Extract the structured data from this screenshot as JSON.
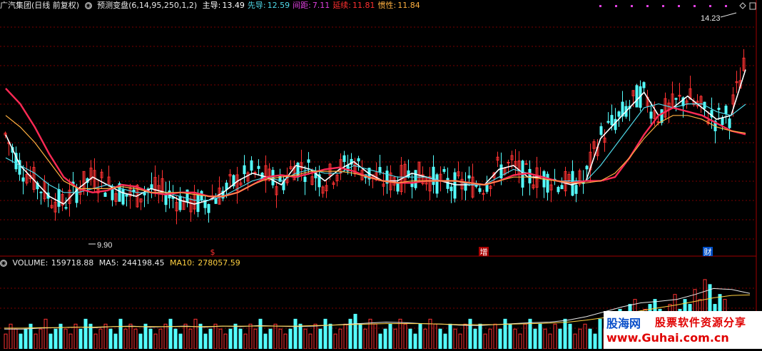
{
  "header": {
    "stock": "广汽集团(日线 前复权)",
    "indicator": "预测变盘(6,14,95,250,1,2)",
    "items": [
      {
        "label": "主导:",
        "value": "13.49",
        "color": "#ffffff"
      },
      {
        "label": "先导:",
        "value": "12.59",
        "color": "#4fd8e8"
      },
      {
        "label": "间距:",
        "value": "7.11",
        "color": "#e040e0"
      },
      {
        "label": "延续:",
        "value": "11.81",
        "color": "#ff3030"
      },
      {
        "label": "惯性:",
        "value": "11.84",
        "color": "#ffb040"
      }
    ]
  },
  "volume_header": {
    "title": "VOLUME:",
    "value": "159718.88",
    "ma5_label": "MA5:",
    "ma5_value": "244198.45",
    "ma10_label": "MA10:",
    "ma10_value": "278057.59"
  },
  "price_labels": {
    "high": "14.23",
    "low": "9.90"
  },
  "markers": [
    "$",
    "增",
    "财"
  ],
  "watermark": {
    "brand": "股海网",
    "slogan": "股票软件资源分享",
    "url": "www.Guhai.com.cn"
  },
  "colors": {
    "up": "#ff3232",
    "down": "#54ffff",
    "main": "#ffffff",
    "lead": "#4fd8e8",
    "continue": "#ff2a55",
    "inertia": "#ffb040",
    "grid": "#7a0000"
  },
  "chart_data": {
    "type": "line",
    "price_range": [
      9.0,
      15.0
    ],
    "series": [
      {
        "name": "主导",
        "values": [
          11.8,
          11.0,
          10.6,
          10.2,
          10.0,
          10.4,
          10.7,
          10.5,
          10.3,
          10.2,
          10.4,
          10.3,
          10.1,
          10.0,
          10.1,
          10.3,
          10.6,
          10.8,
          10.7,
          10.5,
          11.0,
          10.9,
          10.6,
          10.9,
          11.1,
          10.8,
          10.6,
          10.6,
          10.8,
          10.7,
          10.6,
          10.5,
          10.5,
          10.5,
          10.9,
          11.0,
          10.7,
          10.7,
          10.6,
          10.5,
          10.6,
          11.7,
          12.1,
          12.5,
          12.9,
          12.3,
          12.5,
          12.8,
          12.5,
          12.2,
          12.3,
          13.49
        ]
      },
      {
        "name": "先导",
        "values": [
          11.2,
          11.0,
          10.8,
          10.5,
          10.3,
          10.3,
          10.4,
          10.5,
          10.4,
          10.3,
          10.3,
          10.3,
          10.2,
          10.1,
          10.1,
          10.2,
          10.4,
          10.6,
          10.7,
          10.6,
          10.8,
          10.9,
          10.8,
          10.8,
          11.0,
          10.9,
          10.8,
          10.7,
          10.7,
          10.7,
          10.6,
          10.6,
          10.5,
          10.5,
          10.7,
          10.9,
          10.8,
          10.7,
          10.6,
          10.6,
          10.6,
          11.0,
          11.5,
          12.0,
          12.5,
          12.6,
          12.5,
          12.6,
          12.6,
          12.4,
          12.3,
          12.59
        ]
      },
      {
        "name": "延续",
        "values": [
          13.0,
          12.6,
          12.0,
          11.3,
          10.7,
          10.4,
          10.3,
          10.35,
          10.5,
          10.45,
          10.3,
          10.25,
          10.3,
          10.3,
          10.2,
          10.2,
          10.3,
          10.5,
          10.7,
          10.75,
          10.7,
          10.8,
          10.9,
          10.95,
          10.85,
          10.7,
          10.6,
          10.55,
          10.55,
          10.6,
          10.6,
          10.6,
          10.55,
          10.5,
          10.6,
          10.75,
          10.8,
          10.7,
          10.6,
          10.55,
          10.6,
          10.6,
          10.7,
          11.2,
          11.8,
          12.3,
          12.5,
          12.4,
          12.3,
          12.1,
          11.9,
          11.81
        ]
      },
      {
        "name": "惯性",
        "values": [
          12.3,
          12.0,
          11.6,
          11.1,
          10.6,
          10.4,
          10.4,
          10.4,
          10.45,
          10.4,
          10.3,
          10.3,
          10.3,
          10.25,
          10.2,
          10.2,
          10.3,
          10.5,
          10.65,
          10.7,
          10.75,
          10.85,
          10.85,
          10.85,
          10.8,
          10.7,
          10.6,
          10.55,
          10.6,
          10.6,
          10.6,
          10.6,
          10.55,
          10.5,
          10.6,
          10.7,
          10.7,
          10.65,
          10.6,
          10.55,
          10.55,
          10.6,
          10.8,
          11.2,
          11.7,
          12.1,
          12.3,
          12.3,
          12.2,
          12.0,
          11.9,
          11.84
        ]
      }
    ],
    "volume": {
      "values": [
        3,
        5,
        4,
        3,
        4,
        5,
        3,
        4,
        6,
        3,
        4,
        5,
        4,
        3,
        5,
        4,
        6,
        5,
        3,
        4,
        5,
        4,
        3,
        6,
        4,
        5,
        4,
        3,
        5,
        4,
        3,
        4,
        5,
        6,
        4,
        3,
        5,
        4,
        6,
        5,
        3,
        4,
        5,
        4,
        3,
        4,
        5,
        4,
        3,
        5,
        4,
        6,
        3,
        4,
        5,
        4,
        3,
        4,
        6,
        5,
        4,
        3,
        5,
        4,
        6,
        5,
        3,
        4,
        5,
        6,
        7,
        5,
        4,
        6,
        5,
        3,
        4,
        5,
        4,
        6,
        5,
        4,
        3,
        5,
        4,
        6,
        5,
        4,
        3,
        5,
        4,
        3,
        5,
        6,
        4,
        5,
        3,
        4,
        5,
        4,
        6,
        5,
        4,
        3,
        5,
        6,
        4,
        5,
        4,
        3,
        5,
        4,
        6,
        5,
        3,
        4,
        5,
        4,
        3,
        6,
        4,
        5,
        7,
        8,
        6,
        9,
        10,
        7,
        8,
        9,
        10,
        8,
        7,
        9,
        11,
        8,
        10,
        9,
        12,
        10,
        14,
        13,
        9,
        11,
        10
      ],
      "ma5": [
        4.0,
        4.0,
        4.2,
        4.3,
        4.4,
        4.3,
        4.5,
        4.6,
        4.4,
        4.5,
        4.6,
        4.4,
        4.6,
        4.5,
        4.7,
        4.6,
        4.5,
        4.6,
        4.8,
        5.0,
        5.2,
        5.4,
        5.3,
        5.1,
        5.0,
        4.8,
        4.7,
        4.9,
        5.1,
        5.3,
        5.4,
        5.8,
        6.5,
        7.5,
        8.5,
        9.3,
        9.6,
        10.0,
        11.0,
        12.2,
        12.0,
        11.2
      ],
      "ma10": [
        4.2,
        4.2,
        4.3,
        4.3,
        4.4,
        4.4,
        4.5,
        4.5,
        4.5,
        4.5,
        4.5,
        4.5,
        4.6,
        4.6,
        4.6,
        4.6,
        4.6,
        4.7,
        4.8,
        4.9,
        5.0,
        5.1,
        5.1,
        5.1,
        5.0,
        4.9,
        4.9,
        4.9,
        5.0,
        5.1,
        5.2,
        5.4,
        5.8,
        6.3,
        7.0,
        7.7,
        8.3,
        8.9,
        9.6,
        10.3,
        10.8,
        10.9
      ],
      "colors_pattern": "alternating"
    }
  }
}
